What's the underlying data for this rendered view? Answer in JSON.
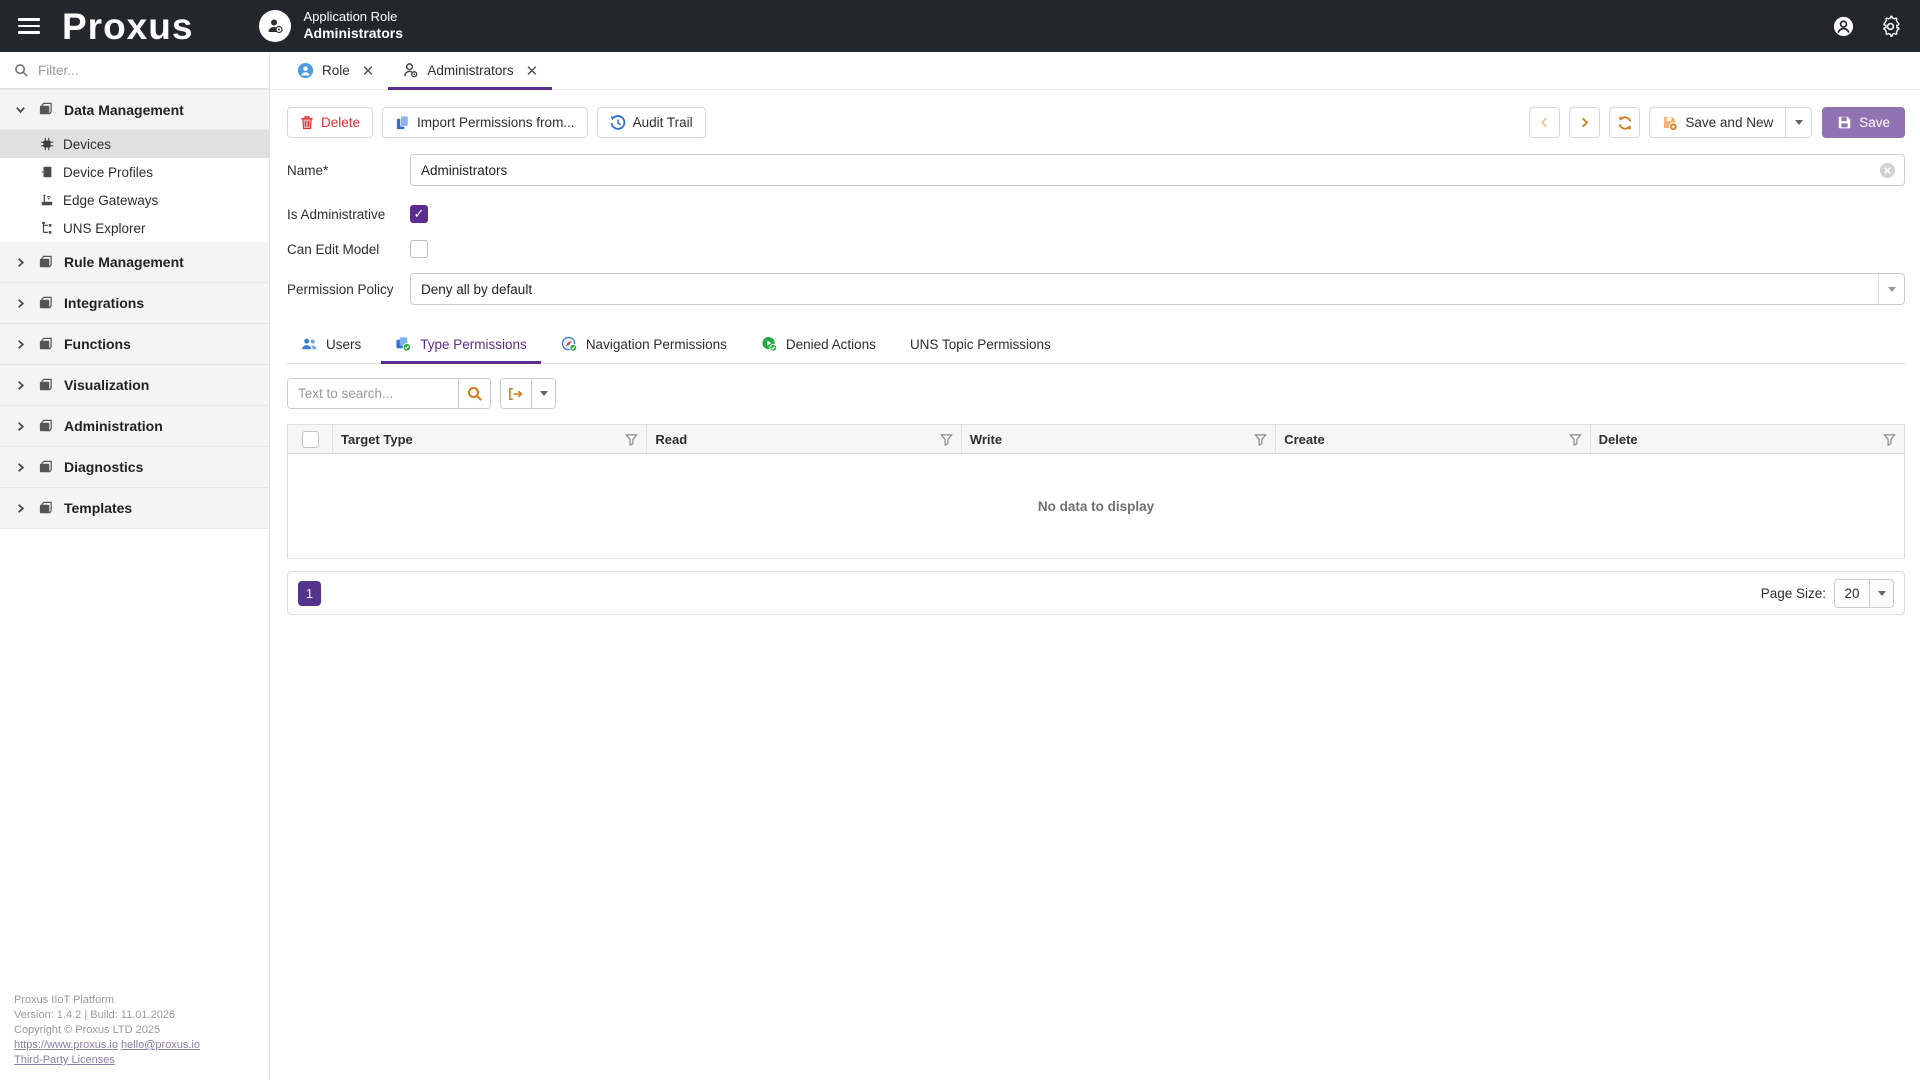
{
  "header": {
    "logo": "Proxus",
    "context_type": "Application Role",
    "context_name": "Administrators"
  },
  "sidebar": {
    "filter_placeholder": "Filter...",
    "sections": [
      {
        "label": "Data Management",
        "expanded": true
      },
      {
        "label": "Rule Management",
        "expanded": false
      },
      {
        "label": "Integrations",
        "expanded": false
      },
      {
        "label": "Functions",
        "expanded": false
      },
      {
        "label": "Visualization",
        "expanded": false
      },
      {
        "label": "Administration",
        "expanded": false
      },
      {
        "label": "Diagnostics",
        "expanded": false
      },
      {
        "label": "Templates",
        "expanded": false
      }
    ],
    "data_management_items": [
      {
        "label": "Devices",
        "selected": true
      },
      {
        "label": "Device Profiles",
        "selected": false
      },
      {
        "label": "Edge Gateways",
        "selected": false
      },
      {
        "label": "UNS Explorer",
        "selected": false
      }
    ],
    "footer": {
      "product": "Proxus IIoT Platform",
      "version": "Version: 1.4.2 | Build: 11.01.2026",
      "copyright": "Copyright © Proxus LTD 2025",
      "website": "https://www.proxus.io",
      "email": "hello@proxus.io",
      "licenses": "Third-Party Licenses"
    }
  },
  "doc_tabs": [
    {
      "label": "Role",
      "active": false
    },
    {
      "label": "Administrators",
      "active": true
    }
  ],
  "toolbar": {
    "delete_label": "Delete",
    "import_label": "Import Permissions from...",
    "audit_label": "Audit Trail",
    "save_and_new_label": "Save and New",
    "save_label": "Save"
  },
  "form": {
    "name_label": "Name*",
    "name_value": "Administrators",
    "is_administrative_label": "Is Administrative",
    "is_administrative_checked": true,
    "can_edit_model_label": "Can Edit Model",
    "can_edit_model_checked": false,
    "permission_policy_label": "Permission Policy",
    "permission_policy_value": "Deny all by default"
  },
  "perm_tabs": [
    {
      "label": "Users",
      "active": false
    },
    {
      "label": "Type Permissions",
      "active": true
    },
    {
      "label": "Navigation Permissions",
      "active": false
    },
    {
      "label": "Denied Actions",
      "active": false
    },
    {
      "label": "UNS Topic Permissions",
      "active": false
    }
  ],
  "grid": {
    "search_placeholder": "Text to search...",
    "columns": [
      "Target Type",
      "Read",
      "Write",
      "Create",
      "Delete"
    ],
    "empty_message": "No data to display",
    "current_page": "1",
    "page_size_label": "Page Size:",
    "page_size_value": "20"
  },
  "colors": {
    "header_bg": "#23272c",
    "accent_purple": "#5c2d91",
    "save_button_purple": "#9173b4",
    "accent_orange": "#d9791a",
    "danger_red": "#e03131",
    "icon_blue": "#3b7fd4",
    "icon_green": "#21a93c"
  }
}
